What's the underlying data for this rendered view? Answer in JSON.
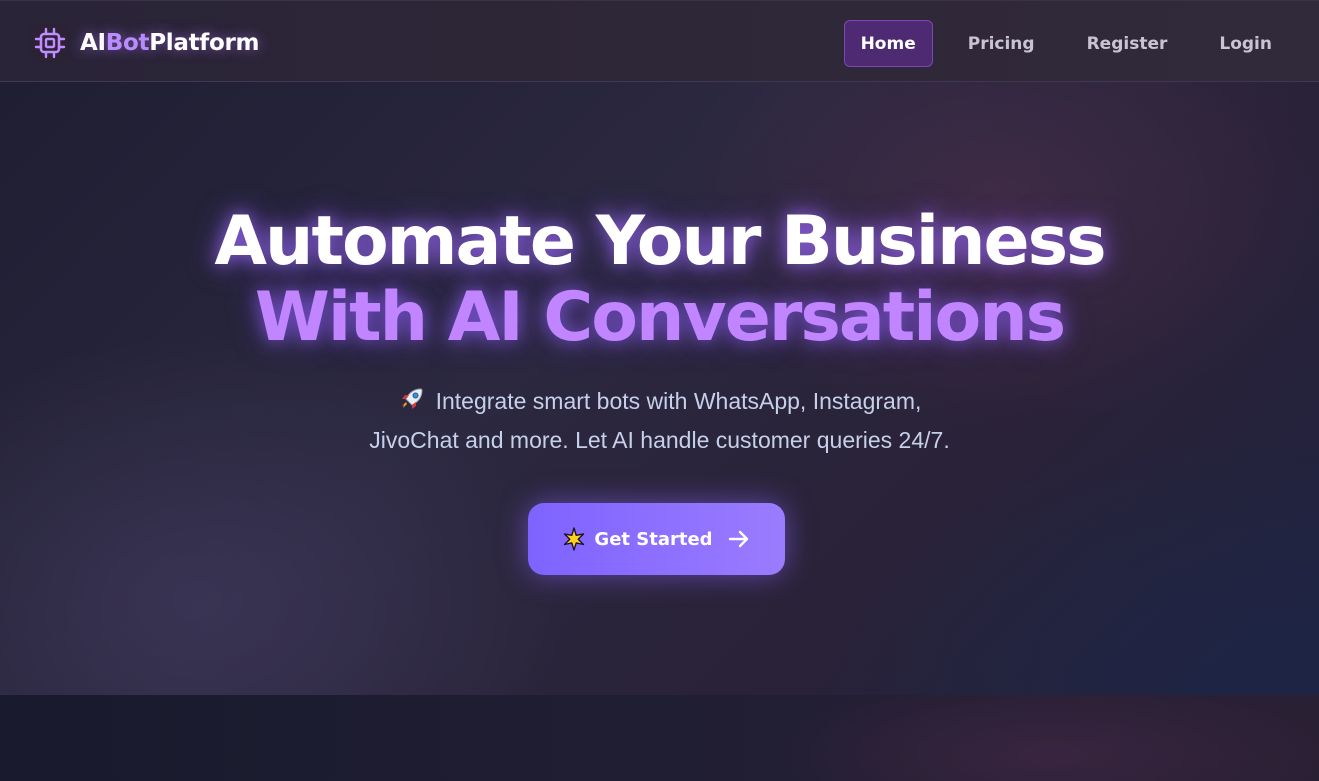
{
  "brand": {
    "prefix": "AI",
    "accent": "Bot",
    "suffix": "Platform",
    "icon": "chip-icon"
  },
  "nav": {
    "items": [
      {
        "label": "Home",
        "active": true
      },
      {
        "label": "Pricing",
        "active": false
      },
      {
        "label": "Register",
        "active": false
      },
      {
        "label": "Login",
        "active": false
      }
    ]
  },
  "hero": {
    "headline_line1": "Automate Your Business",
    "headline_line2": "With AI Conversations",
    "subtitle_line1": "Integrate smart bots with WhatsApp, Instagram,",
    "subtitle_line2": "JivoChat and more. Let AI handle customer queries 24/7.",
    "subtitle_icon": "rocket-icon",
    "cta_label": "Get Started",
    "cta_icon_left": "sparkle-star-icon",
    "cta_icon_right": "arrow-right-icon"
  },
  "colors": {
    "accent_purple": "#b98cff",
    "headline_purple": "#c185ff",
    "nav_active_bg": "#4d2a72",
    "cta_gradient_start": "#7e63ff",
    "cta_gradient_end": "#9a7cff"
  }
}
